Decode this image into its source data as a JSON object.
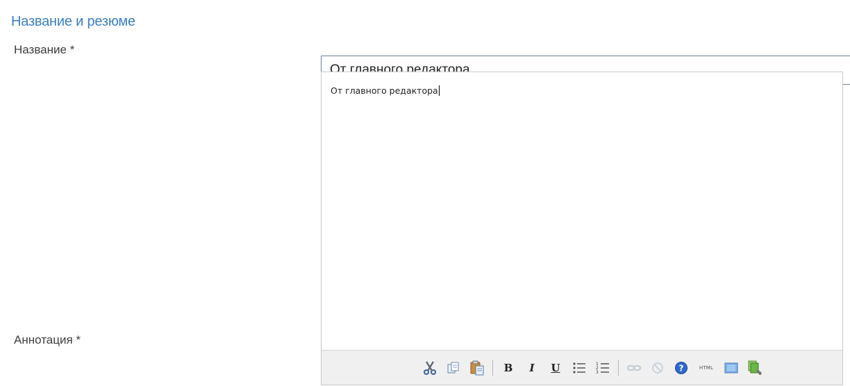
{
  "section": {
    "title": "Название и резюме"
  },
  "fields": {
    "title_label": "Название *",
    "title_value": "От главного редактора",
    "annotation_label": "Аннотация *",
    "annotation_text": "От главного редактора"
  },
  "toolbar": {
    "bold": "B",
    "italic": "I",
    "underline": "U",
    "html": "HTML"
  }
}
